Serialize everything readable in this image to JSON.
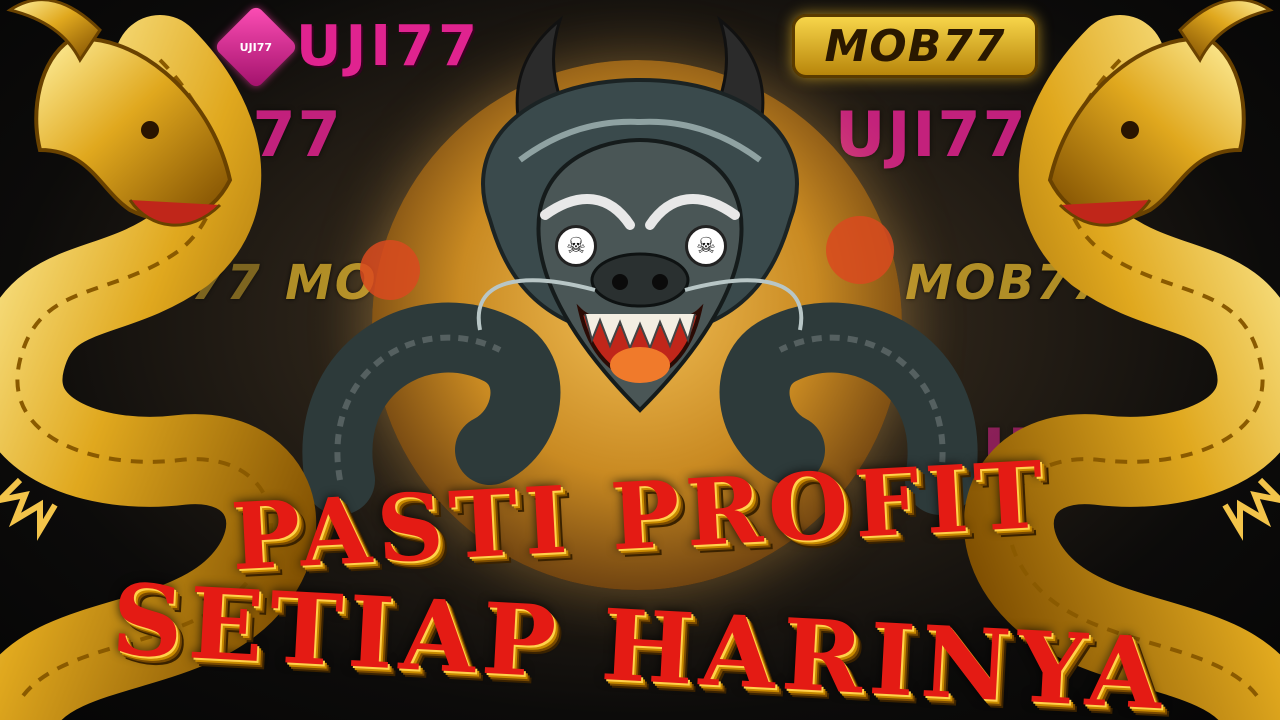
{
  "watermark": {
    "uji_text": "UJI77",
    "mob_text": "MOB77"
  },
  "logos": {
    "uji_badge": "UJI77",
    "uji_word": "UJI77",
    "mob_word": "MOB77"
  },
  "headline": {
    "line1": "PASTI PROFIT",
    "line2": "SETIAP HARINYA"
  },
  "icons": {
    "skull_left": "skull-icon",
    "skull_right": "skull-icon"
  },
  "colors": {
    "uji_pink": "#e0238f",
    "mob_gold": "#f7d54a",
    "headline_red": "#e41b14",
    "dragon_gold": "#e0a81e"
  }
}
